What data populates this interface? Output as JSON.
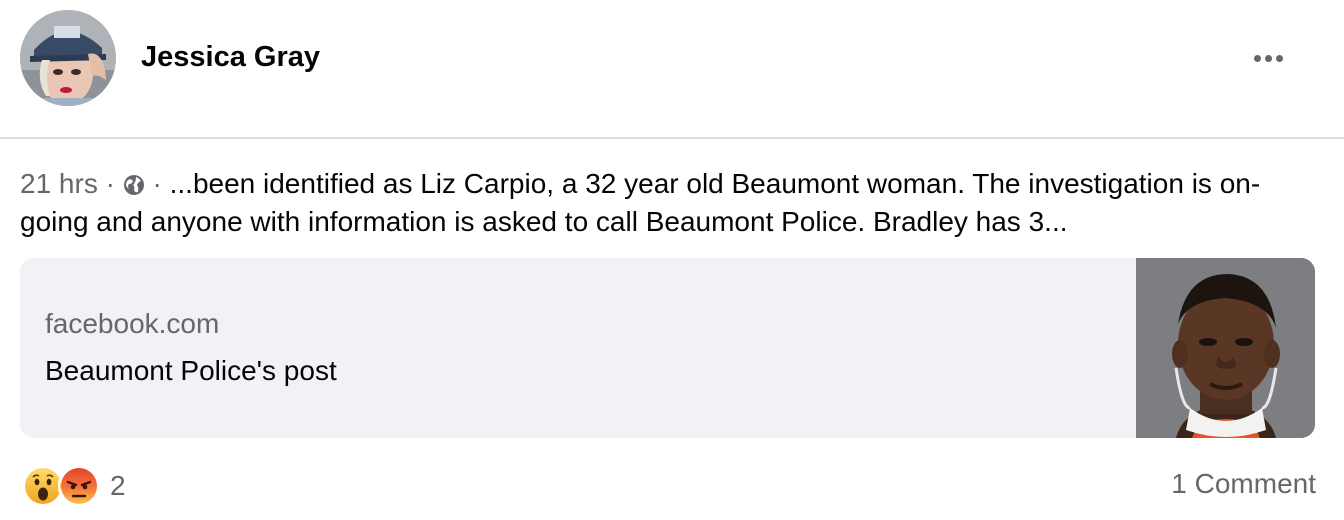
{
  "post": {
    "author": "Jessica Gray",
    "time": "21 hrs",
    "separator": "·",
    "visibility_icon": "globe-icon",
    "text": "...been identified as Liz Carpio, a 32 year old Beaumont woman. The investigation is on-going and anyone with information is asked to call Beaumont Police. Bradley has 3..."
  },
  "link_preview": {
    "domain": "facebook.com",
    "title": "Beaumont Police's post"
  },
  "footer": {
    "reaction_icons": [
      "wow-reaction-icon",
      "angry-reaction-icon"
    ],
    "reaction_count": "2",
    "comments_label": "1 Comment"
  },
  "colors": {
    "text_primary": "#050505",
    "text_secondary": "#65676b",
    "card_background": "#f0f2f5",
    "divider": "#dadde1"
  }
}
